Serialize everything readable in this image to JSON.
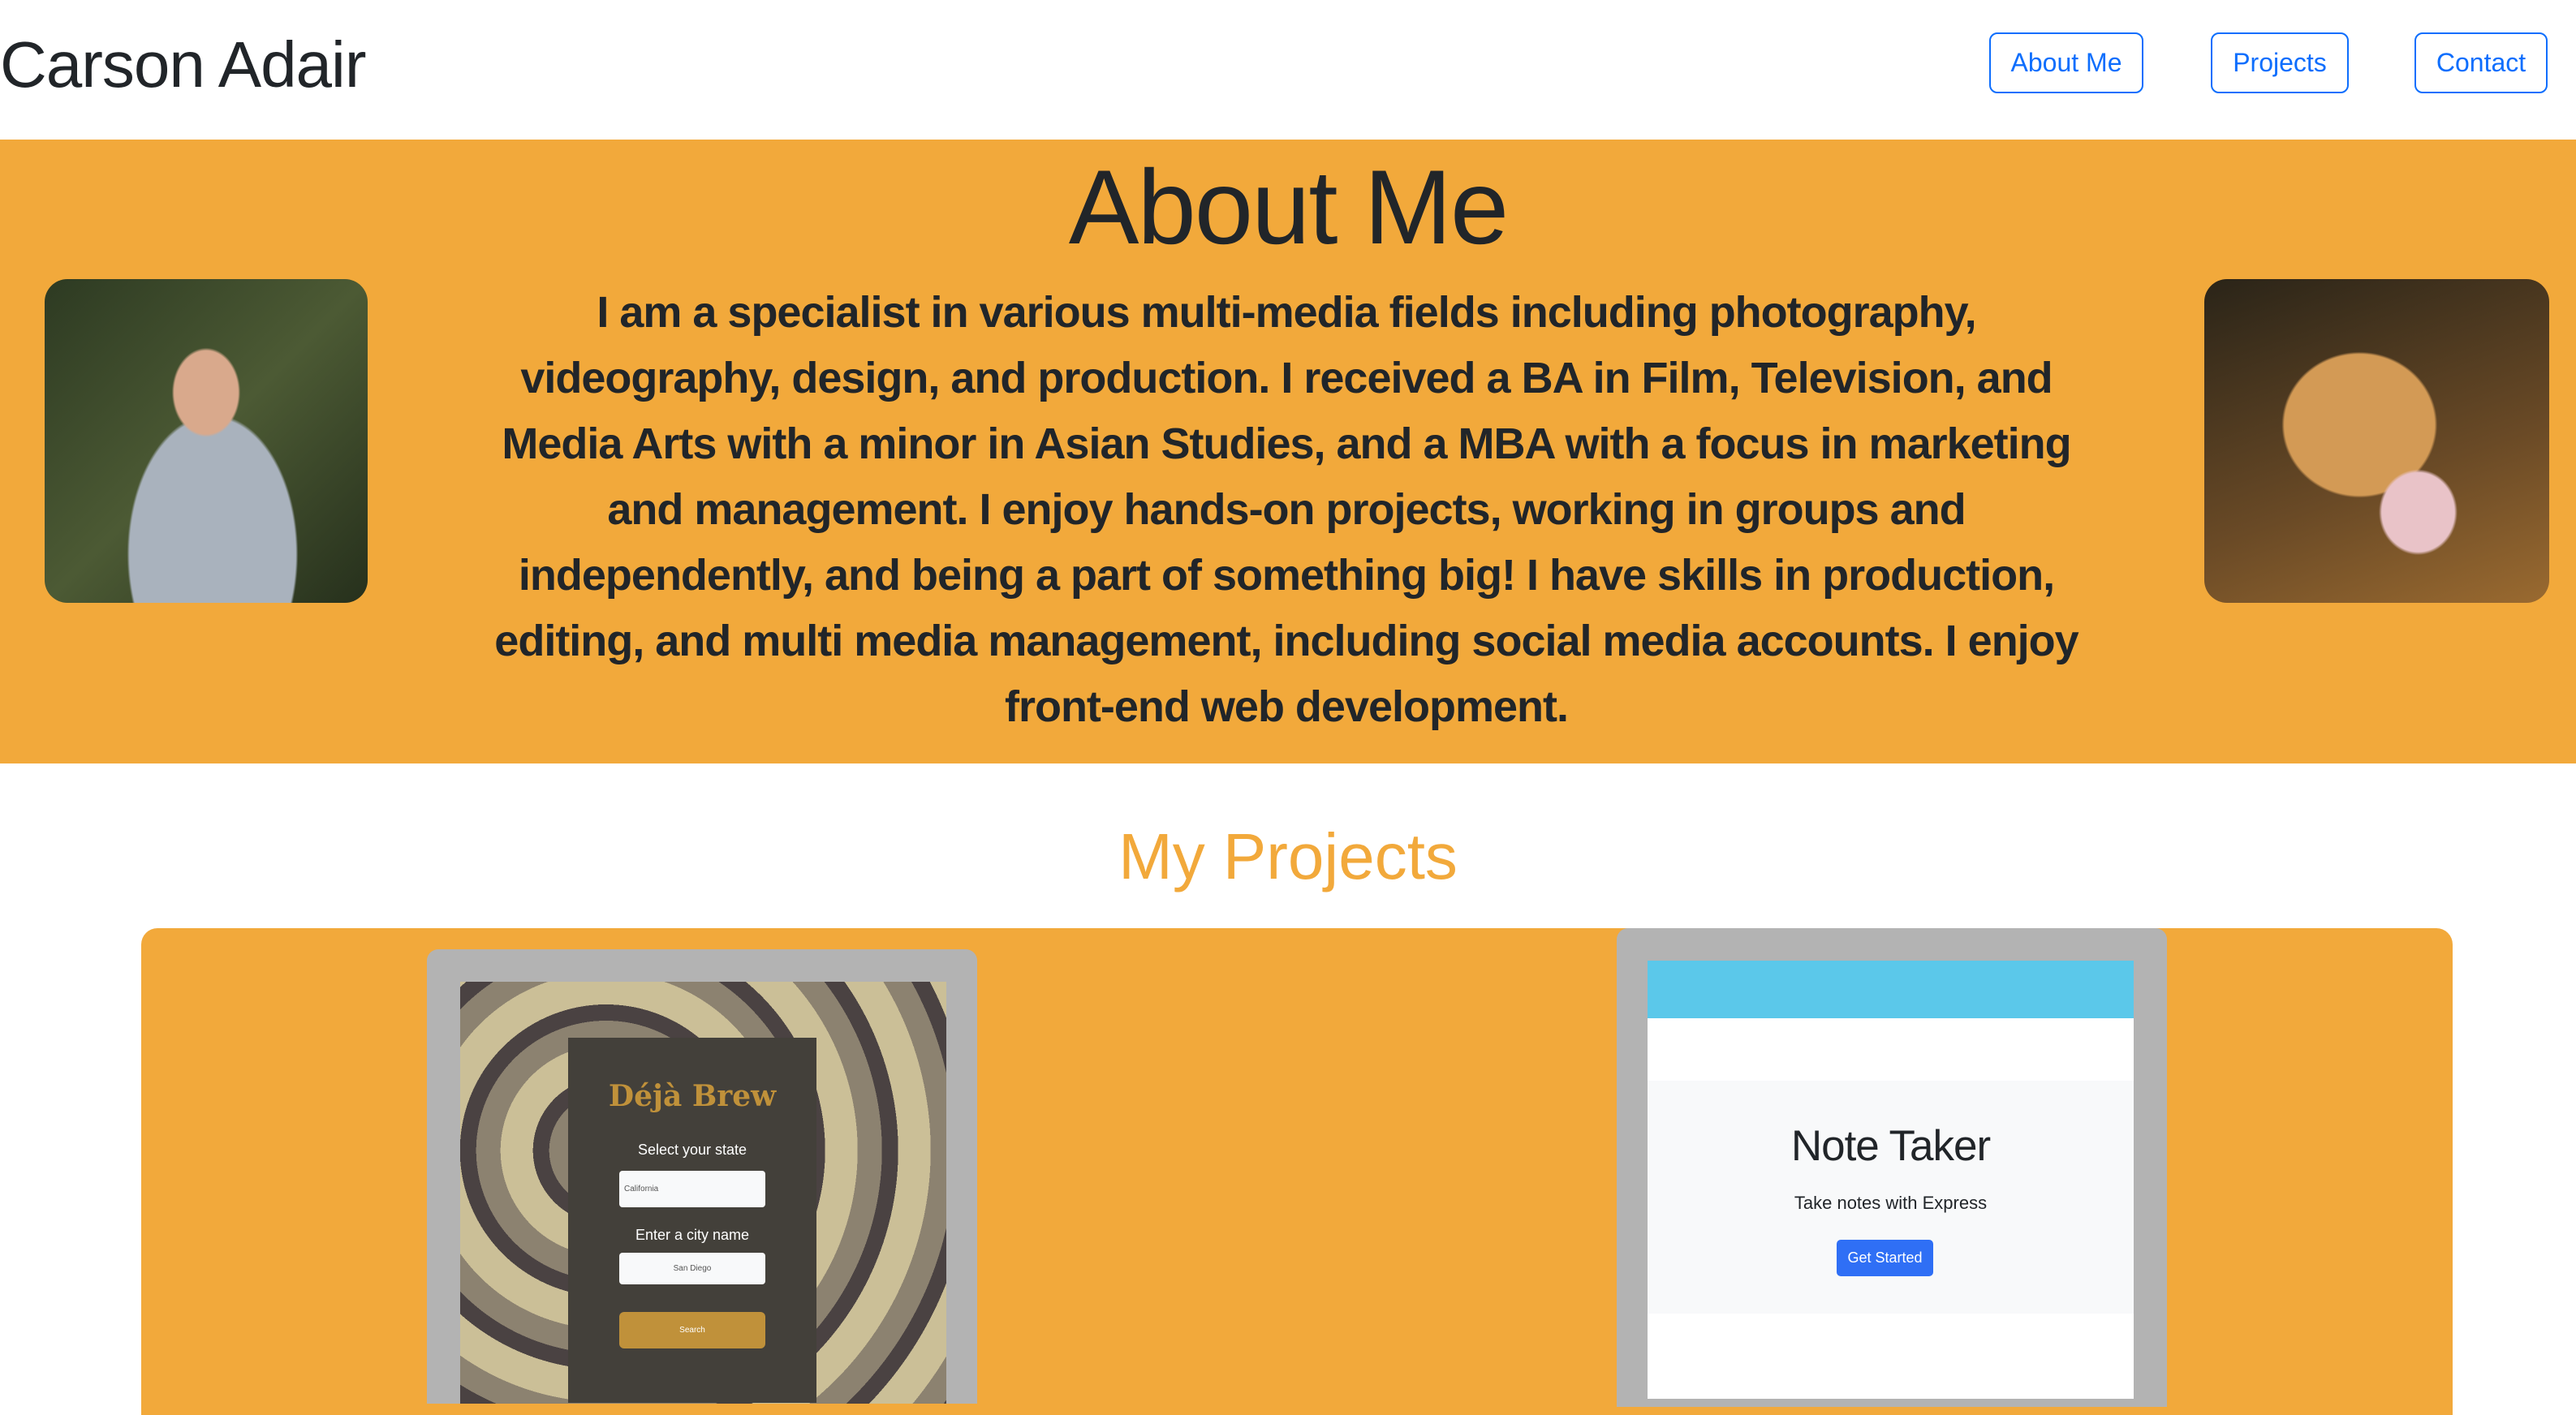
{
  "header": {
    "brand": "Carson Adair",
    "nav": [
      {
        "label": "About Me"
      },
      {
        "label": "Projects"
      },
      {
        "label": "Contact"
      }
    ]
  },
  "about": {
    "title": "About Me",
    "text": "I am a specialist in various multi-media fields including photography, videography, design, and production. I received a BA in Film, Television, and Media Arts with a minor in Asian Studies, and a MBA with a focus in marketing and management. I enjoy hands-on projects, working in groups and independently, and being a part of something big! I have skills in production, editing, and multi media management, including social media accounts. I enjoy front-end web development."
  },
  "projects": {
    "title": "My Projects",
    "deja_brew": {
      "title": "Déjà Brew",
      "state_label": "Select your state",
      "state_value": "California",
      "city_label": "Enter a city name",
      "city_placeholder": "San Diego",
      "search_label": "Search"
    },
    "note_taker": {
      "title": "Note Taker",
      "subtitle": "Take notes with Express",
      "button": "Get Started"
    }
  },
  "colors": {
    "accent": "#f2a93b",
    "link": "#0d6efd"
  }
}
